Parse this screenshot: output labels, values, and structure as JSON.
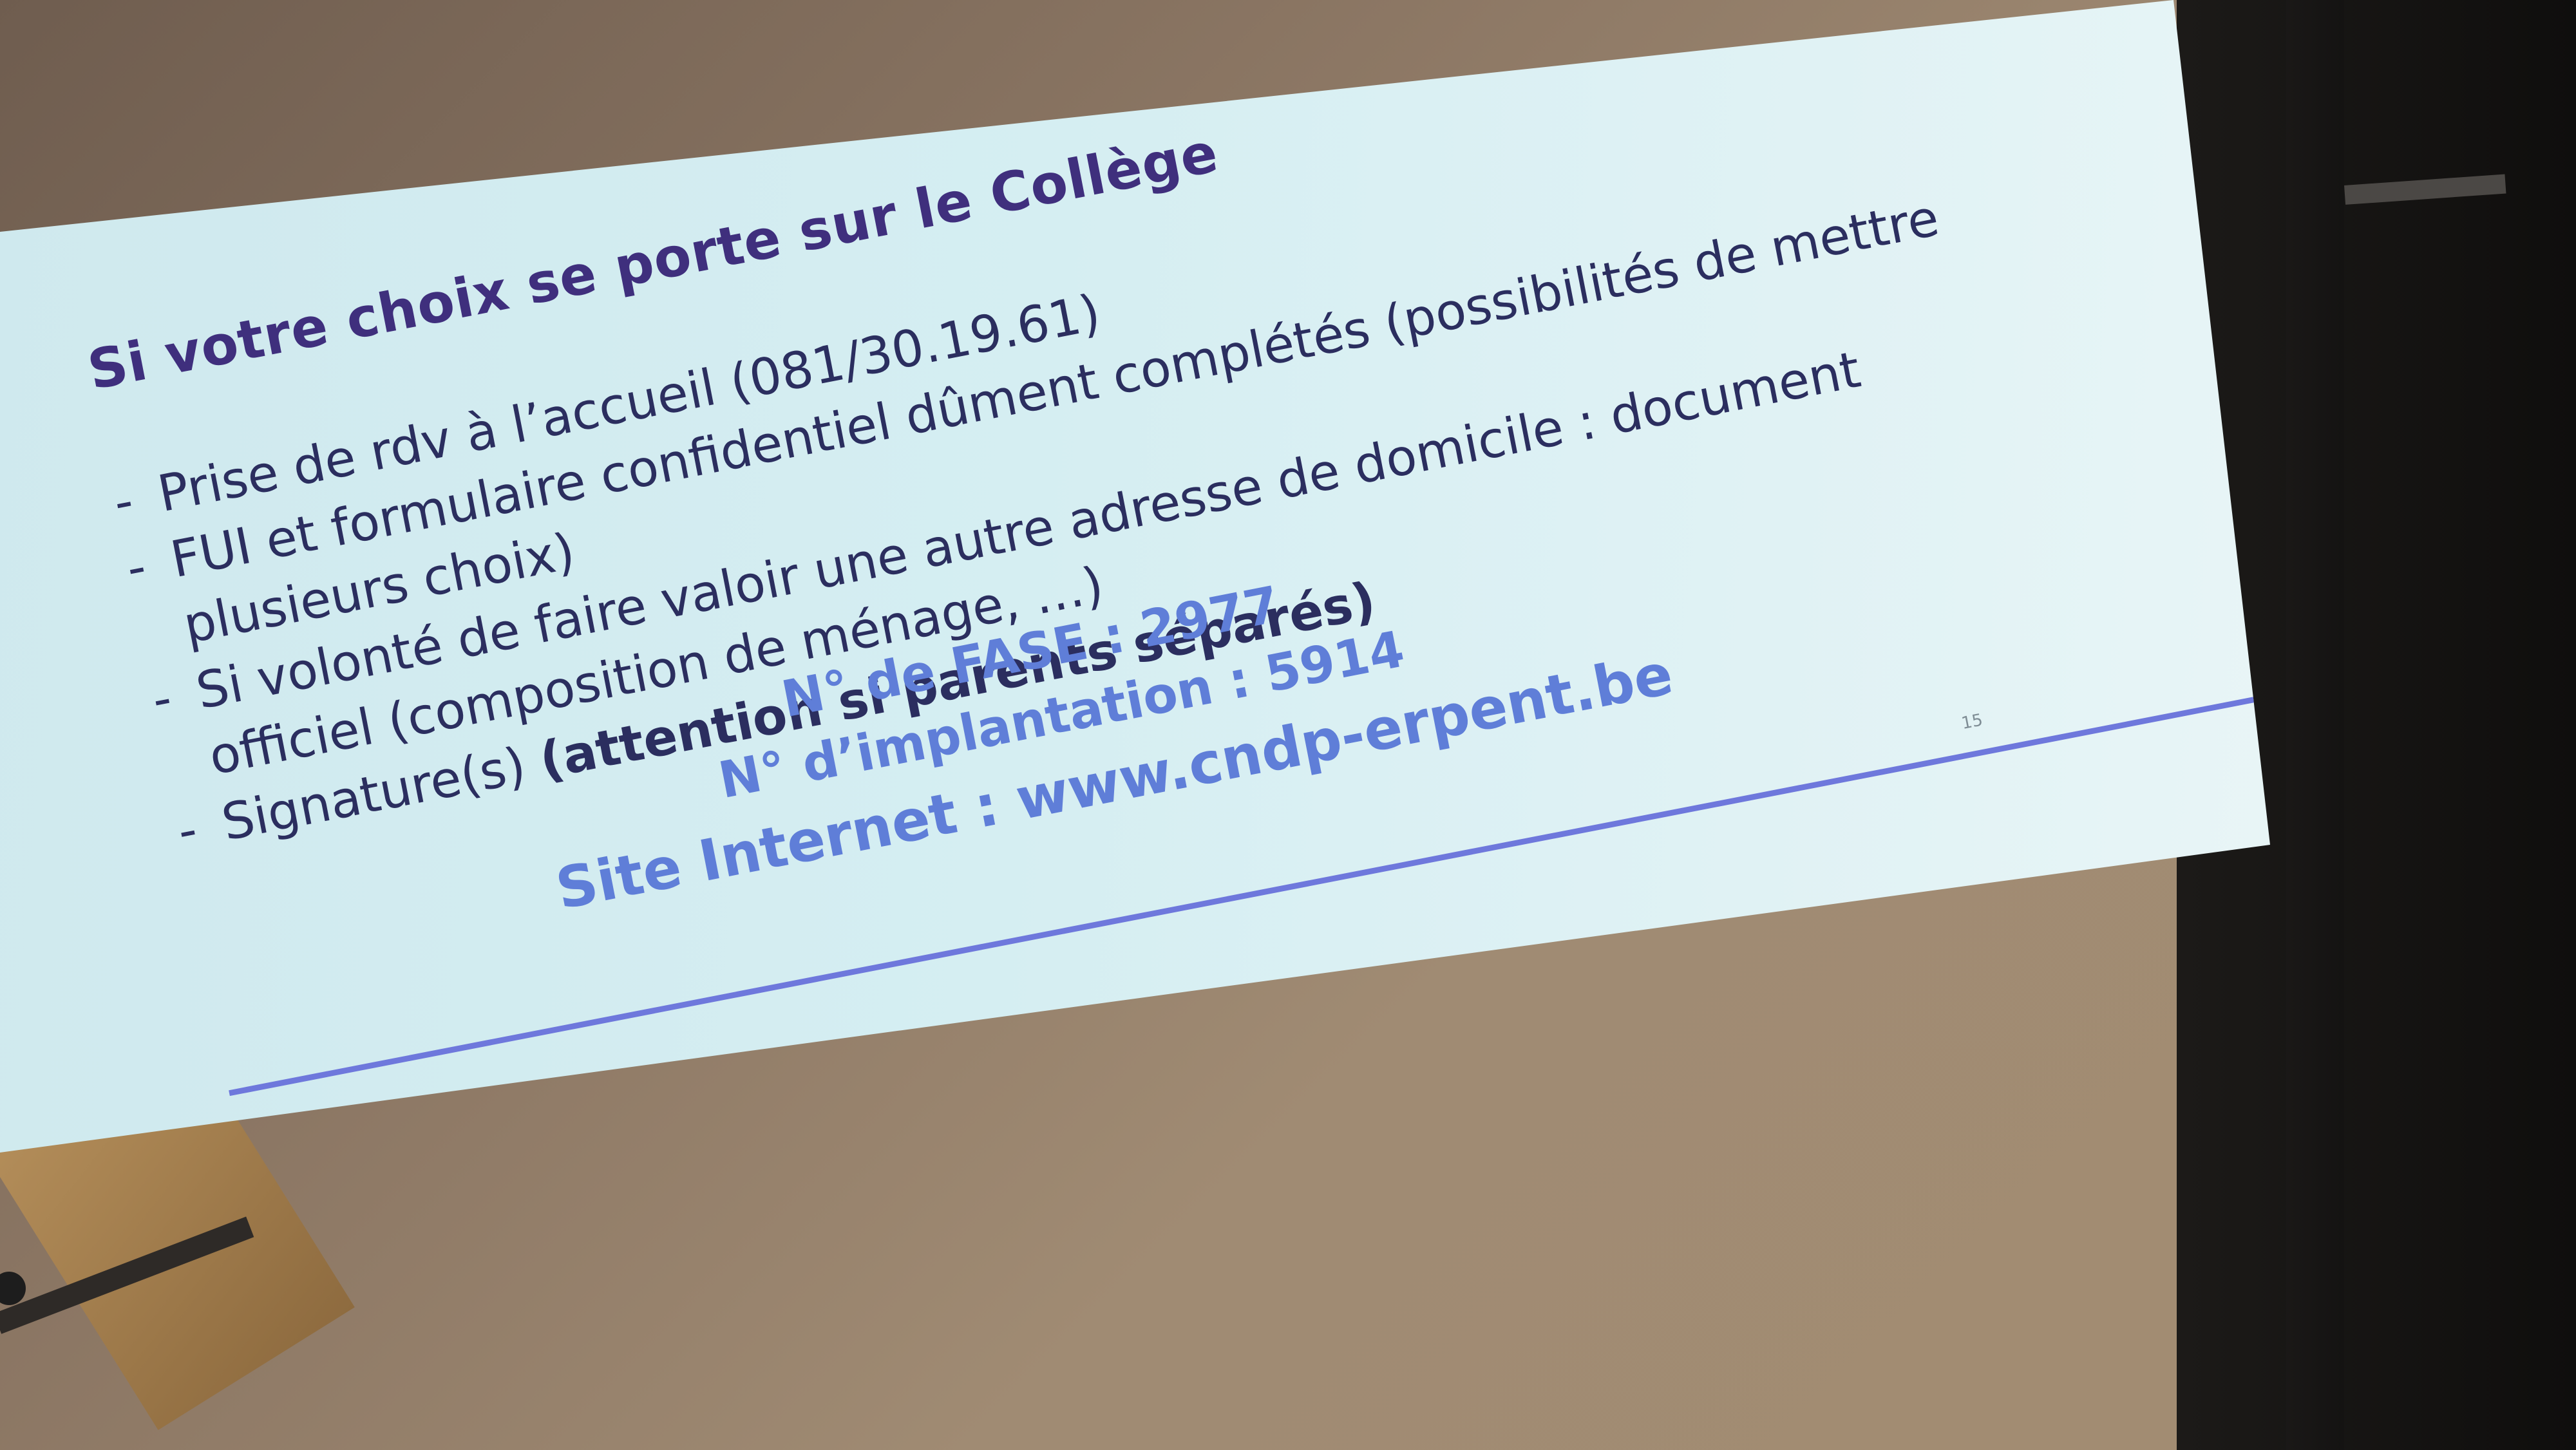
{
  "slide": {
    "title": "Si votre choix se porte sur le Collège",
    "bullets": [
      {
        "dash": "-",
        "text": "Prise de rdv à l’accueil (081/30.19.61)"
      },
      {
        "dash": "-",
        "text": "FUI et formulaire confidentiel dûment complétés (possibilités de mettre plusieurs choix)"
      },
      {
        "dash": "-",
        "text": "Si volonté de faire valoir une autre adresse de domicile  : document officiel (composition de ménage, …)"
      },
      {
        "dash": "-",
        "text_plain": "Signature(s) ",
        "text_strong": "(attention si parents séparés)"
      }
    ],
    "fase_line": "N° de FASE : 2977",
    "implantation_line": "N° d’implantation : 5914",
    "website_line": "Site Internet : www.cndp-erpent.be",
    "page_number": "15"
  },
  "colors": {
    "slide_background": "#d5eef2",
    "title": "#3f2f7d",
    "body_text": "#2b2e5f",
    "info_text": "#5f7ed8",
    "rule": "#6e78dc"
  }
}
